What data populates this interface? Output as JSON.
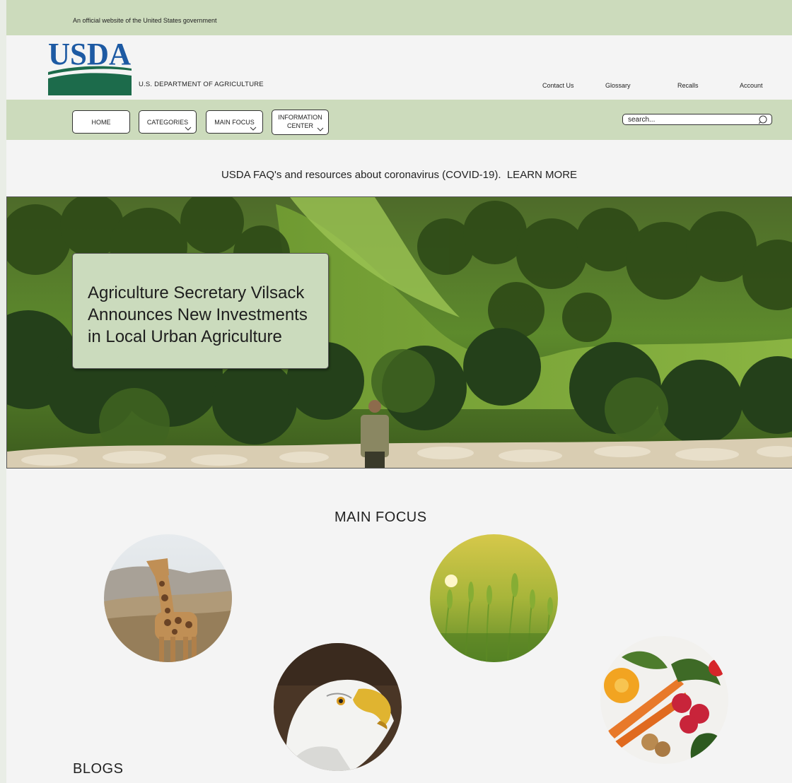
{
  "gov_banner": {
    "text": "An  official website of the United States government"
  },
  "header": {
    "logo_text": "USDA",
    "department": "U.S. DEPARTMENT OF AGRICULTURE",
    "utility_links": [
      "Contact Us",
      "Glossary",
      "Recalls",
      "Account"
    ]
  },
  "nav": {
    "home": "HOME",
    "categories": "CATEGORIES",
    "main_focus": "MAIN FOCUS",
    "info_line1": "INFORMATION",
    "info_line2": "CENTER",
    "search_placeholder": "search..."
  },
  "notice": {
    "text": "USDA FAQ's and resources about coronavirus (COVID-19).",
    "link": "LEARN MORE"
  },
  "hero": {
    "headline": "Agriculture Secretary Vilsack Announces New Investments in Local Urban Agriculture"
  },
  "main_focus": {
    "title": "MAIN FOCUS",
    "items": [
      "giraffe",
      "bald eagle",
      "wheat field",
      "vegetables"
    ]
  },
  "blogs": {
    "title": "BLOGS"
  },
  "colors": {
    "banner_green": "#ccdbbc",
    "logo_blue": "#1d5aa3",
    "logo_green": "#1c6b4b",
    "card_green": "#cbdbbd"
  }
}
